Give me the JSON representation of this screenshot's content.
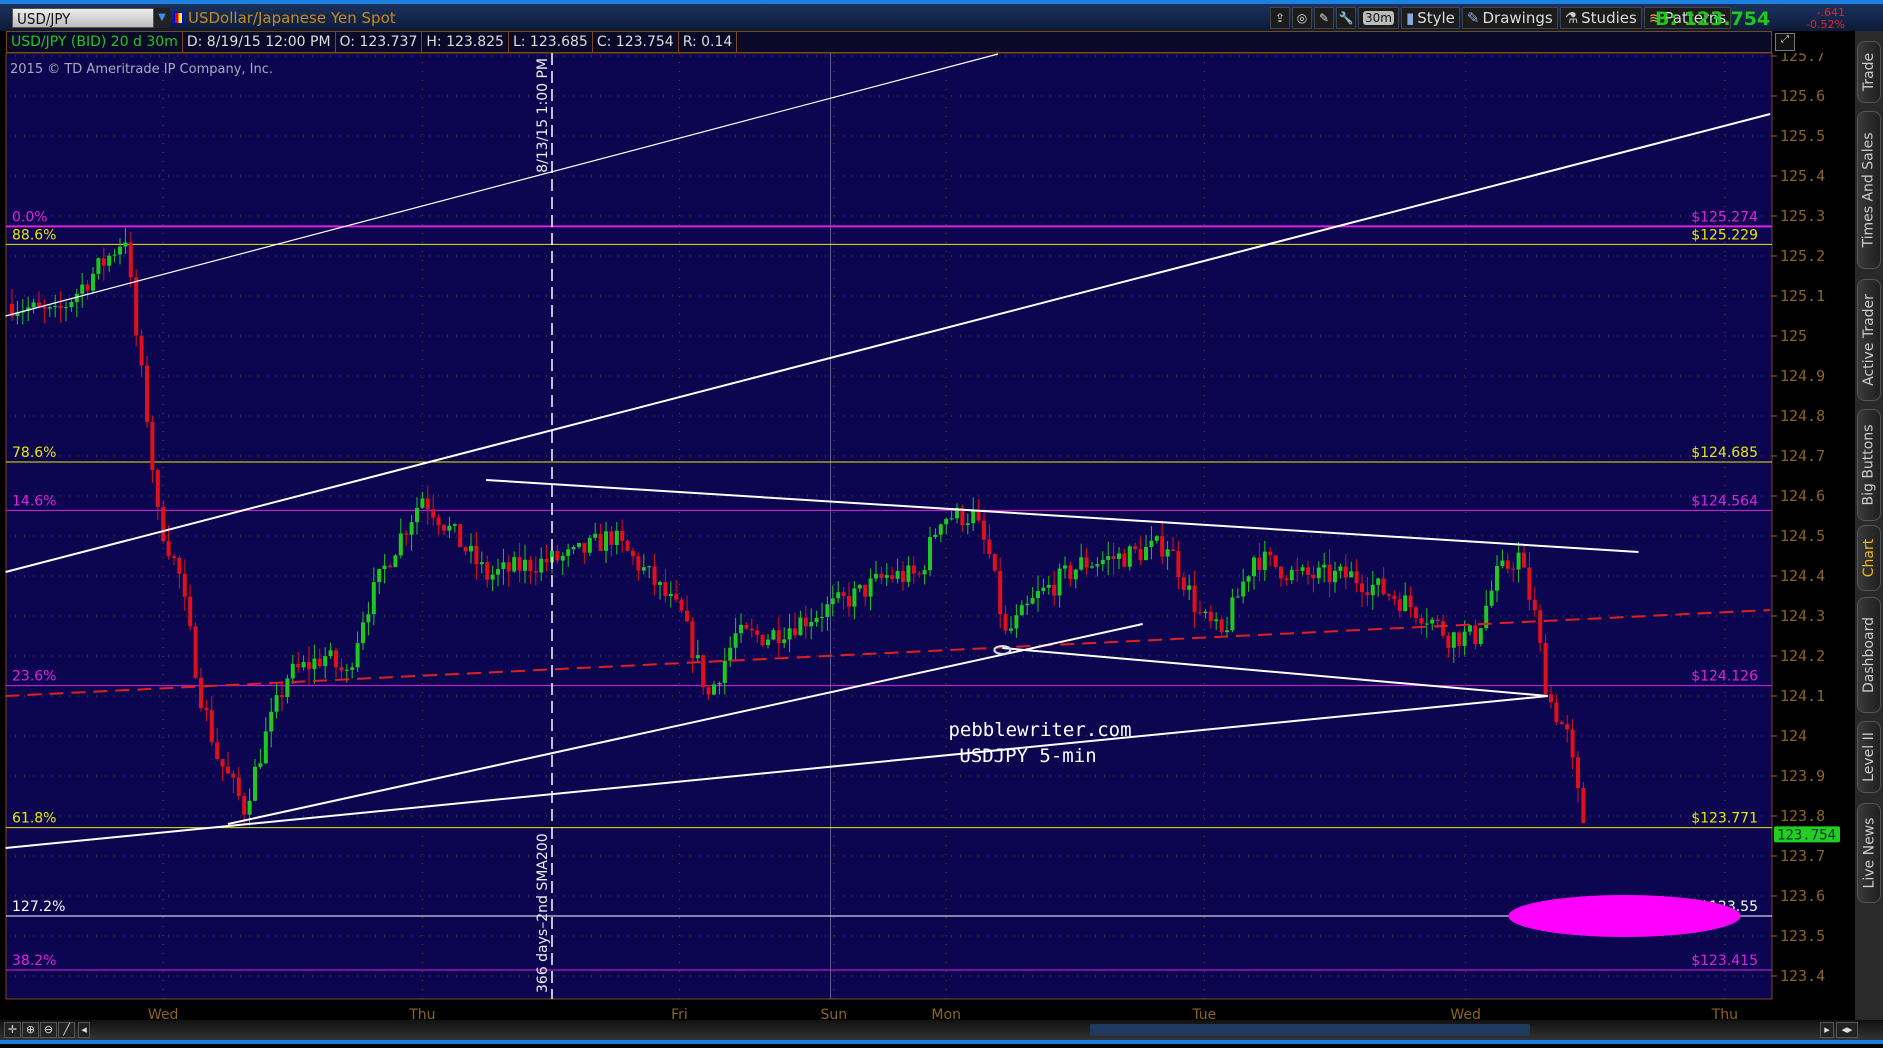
{
  "header": {
    "symbol": "USD/JPY",
    "description": "USDollar/Japanese Yen Spot",
    "tools": [
      {
        "icon": "share-icon",
        "label": ""
      },
      {
        "icon": "settings-circle-icon",
        "label": ""
      },
      {
        "icon": "tools-icon",
        "label": ""
      },
      {
        "icon": "wrench-icon",
        "label": ""
      },
      {
        "icon": "aggregation",
        "label": "30m"
      },
      {
        "icon": "candle-style-icon",
        "label": "Style"
      },
      {
        "icon": "pencil-icon",
        "label": "Drawings"
      },
      {
        "icon": "studies-icon",
        "label": "Studies"
      },
      {
        "icon": "patterns-icon",
        "label": "Patterns"
      }
    ],
    "bid": "B: 123.754",
    "change": "-.641",
    "change_pct": "-0.52%"
  },
  "infobar": {
    "title": "USD/JPY (BID) 20 d 30m",
    "date": "D: 8/19/15 12:00 PM",
    "open": "O: 123.737",
    "high": "H: 123.825",
    "low": "L: 123.685",
    "close": "C: 123.754",
    "range": "R: 0.14"
  },
  "copyright": "2015 © TD Ameritrade IP Company, Inc.",
  "annotations": {
    "vline_top": "8/13/15 1:00 PM",
    "vline_bottom": "366 days–2nd SMA200",
    "watermark1": "pebblewriter.com",
    "watermark2": "USDJPY 5-min"
  },
  "right_tabs": [
    {
      "label": "Trade"
    },
    {
      "label": "Times And Sales"
    },
    {
      "label": "Active Trader"
    },
    {
      "label": "Big Buttons"
    },
    {
      "label": "Chart",
      "active": true
    },
    {
      "label": "Dashboard"
    },
    {
      "label": "Level II"
    },
    {
      "label": "Live News"
    }
  ],
  "colors": {
    "bg": "#0c0650",
    "up": "#1ec81e",
    "down": "#e0101a",
    "fib_yellow": "#e8e800",
    "fib_magenta": "#e020e0",
    "axis": "#8a6424",
    "ellipse": "#ff00ff"
  },
  "chart_data": {
    "type": "candlestick",
    "symbol": "USD/JPY",
    "interval": "30m",
    "ylim": [
      123.35,
      125.72
    ],
    "yticks": [
      "125.7",
      "125.6",
      "125.5",
      "125.4",
      "125.3",
      "125.2",
      "125.1",
      "125",
      "124.9",
      "124.8",
      "124.7",
      "124.6",
      "124.5",
      "124.4",
      "124.3",
      "124.2",
      "124.1",
      "124",
      "123.9",
      "123.8",
      "123.7",
      "123.6",
      "123.5",
      "123.4"
    ],
    "xticks": [
      {
        "label": "Wed",
        "h": 0
      },
      {
        "label": "Thu",
        "h": 24
      },
      {
        "label": "Fri",
        "h": 47.8
      },
      {
        "label": "Sun",
        "h": 62.1
      },
      {
        "label": "Mon",
        "h": 72.5
      },
      {
        "label": "Tue",
        "h": 96.4
      },
      {
        "label": "Wed",
        "h": 120.6
      },
      {
        "label": "Thu",
        "h": 144.6
      }
    ],
    "xlim_hours": [
      -14.6,
      148.8
    ],
    "close_path": [
      [
        -14,
        125.08
      ],
      [
        -10,
        125.05
      ],
      [
        -5,
        125.2
      ],
      [
        -3.5,
        125.25
      ],
      [
        -2.5,
        125.0
      ],
      [
        -1.5,
        124.8
      ],
      [
        -0.5,
        124.55
      ],
      [
        1.5,
        124.4
      ],
      [
        3.5,
        124.1
      ],
      [
        5,
        123.95
      ],
      [
        7.5,
        123.82
      ],
      [
        9.5,
        124.0
      ],
      [
        11.5,
        124.15
      ],
      [
        15,
        124.2
      ],
      [
        17,
        124.15
      ],
      [
        18.5,
        124.3
      ],
      [
        21,
        124.45
      ],
      [
        24,
        124.6
      ],
      [
        27,
        124.5
      ],
      [
        30,
        124.4
      ],
      [
        34,
        124.43
      ],
      [
        38,
        124.45
      ],
      [
        41.5,
        124.5
      ],
      [
        45,
        124.4
      ],
      [
        48,
        124.3
      ],
      [
        50.5,
        124.1
      ],
      [
        53,
        124.25
      ],
      [
        56,
        124.25
      ],
      [
        60,
        124.3
      ],
      [
        64,
        124.35
      ],
      [
        67,
        124.4
      ],
      [
        70,
        124.4
      ],
      [
        72,
        124.55
      ],
      [
        75,
        124.55
      ],
      [
        76.5,
        124.45
      ],
      [
        78,
        124.25
      ],
      [
        81,
        124.35
      ],
      [
        85,
        124.43
      ],
      [
        89,
        124.45
      ],
      [
        93,
        124.48
      ],
      [
        96,
        124.3
      ],
      [
        98,
        124.25
      ],
      [
        101,
        124.45
      ],
      [
        105,
        124.4
      ],
      [
        110,
        124.4
      ],
      [
        114,
        124.35
      ],
      [
        117,
        124.3
      ],
      [
        119,
        124.25
      ],
      [
        121.5,
        124.25
      ],
      [
        123.5,
        124.4
      ],
      [
        125.5,
        124.45
      ],
      [
        127,
        124.3
      ],
      [
        128.2,
        124.1
      ],
      [
        130,
        124.0
      ],
      [
        131,
        123.85
      ],
      [
        131.8,
        123.754
      ]
    ],
    "fib_levels": [
      {
        "pct": "0.0%",
        "price": 125.274,
        "label": "$125.274",
        "color": "magenta"
      },
      {
        "pct": "88.6%",
        "price": 125.229,
        "label": "$125.229",
        "color": "yellow"
      },
      {
        "pct": "78.6%",
        "price": 124.685,
        "label": "$124.685",
        "color": "yellow"
      },
      {
        "pct": "14.6%",
        "price": 124.564,
        "label": "$124.564",
        "color": "magenta"
      },
      {
        "pct": "23.6%",
        "price": 124.126,
        "label": "$124.126",
        "color": "magenta"
      },
      {
        "pct": "61.8%",
        "price": 123.771,
        "label": "$123.771",
        "color": "yellow"
      },
      {
        "pct": "127.2%",
        "price": 123.55,
        "label": "$123.55",
        "color": "white"
      },
      {
        "pct": "38.2%",
        "price": 123.415,
        "label": "$123.415",
        "color": "magenta"
      }
    ],
    "trendlines": [
      {
        "from": [
          -14.6,
          125.05
        ],
        "to": [
          77.3,
          125.705
        ],
        "style": "thin"
      },
      {
        "from": [
          -14.6,
          124.41
        ],
        "to": [
          148.8,
          125.555
        ],
        "style": "solid"
      },
      {
        "from": [
          29.9,
          124.64
        ],
        "to": [
          136.6,
          124.46
        ],
        "style": "solid"
      },
      {
        "from": [
          -14.6,
          124.1
        ],
        "to": [
          148.8,
          124.315
        ],
        "style": "red-dashed"
      },
      {
        "from": [
          -14.6,
          123.72
        ],
        "to": [
          128.2,
          124.1
        ],
        "style": "solid"
      },
      {
        "from": [
          6,
          123.78
        ],
        "to": [
          90.7,
          124.28
        ],
        "style": "solid"
      },
      {
        "from": [
          77.7,
          124.22
        ],
        "to": [
          128.2,
          124.1
        ],
        "style": "solid"
      }
    ],
    "vline_hour": 36,
    "week_separator_hour": 61.8,
    "target_ellipse": {
      "hour": 135.3,
      "price": 123.55
    },
    "last_price": "123.754"
  }
}
